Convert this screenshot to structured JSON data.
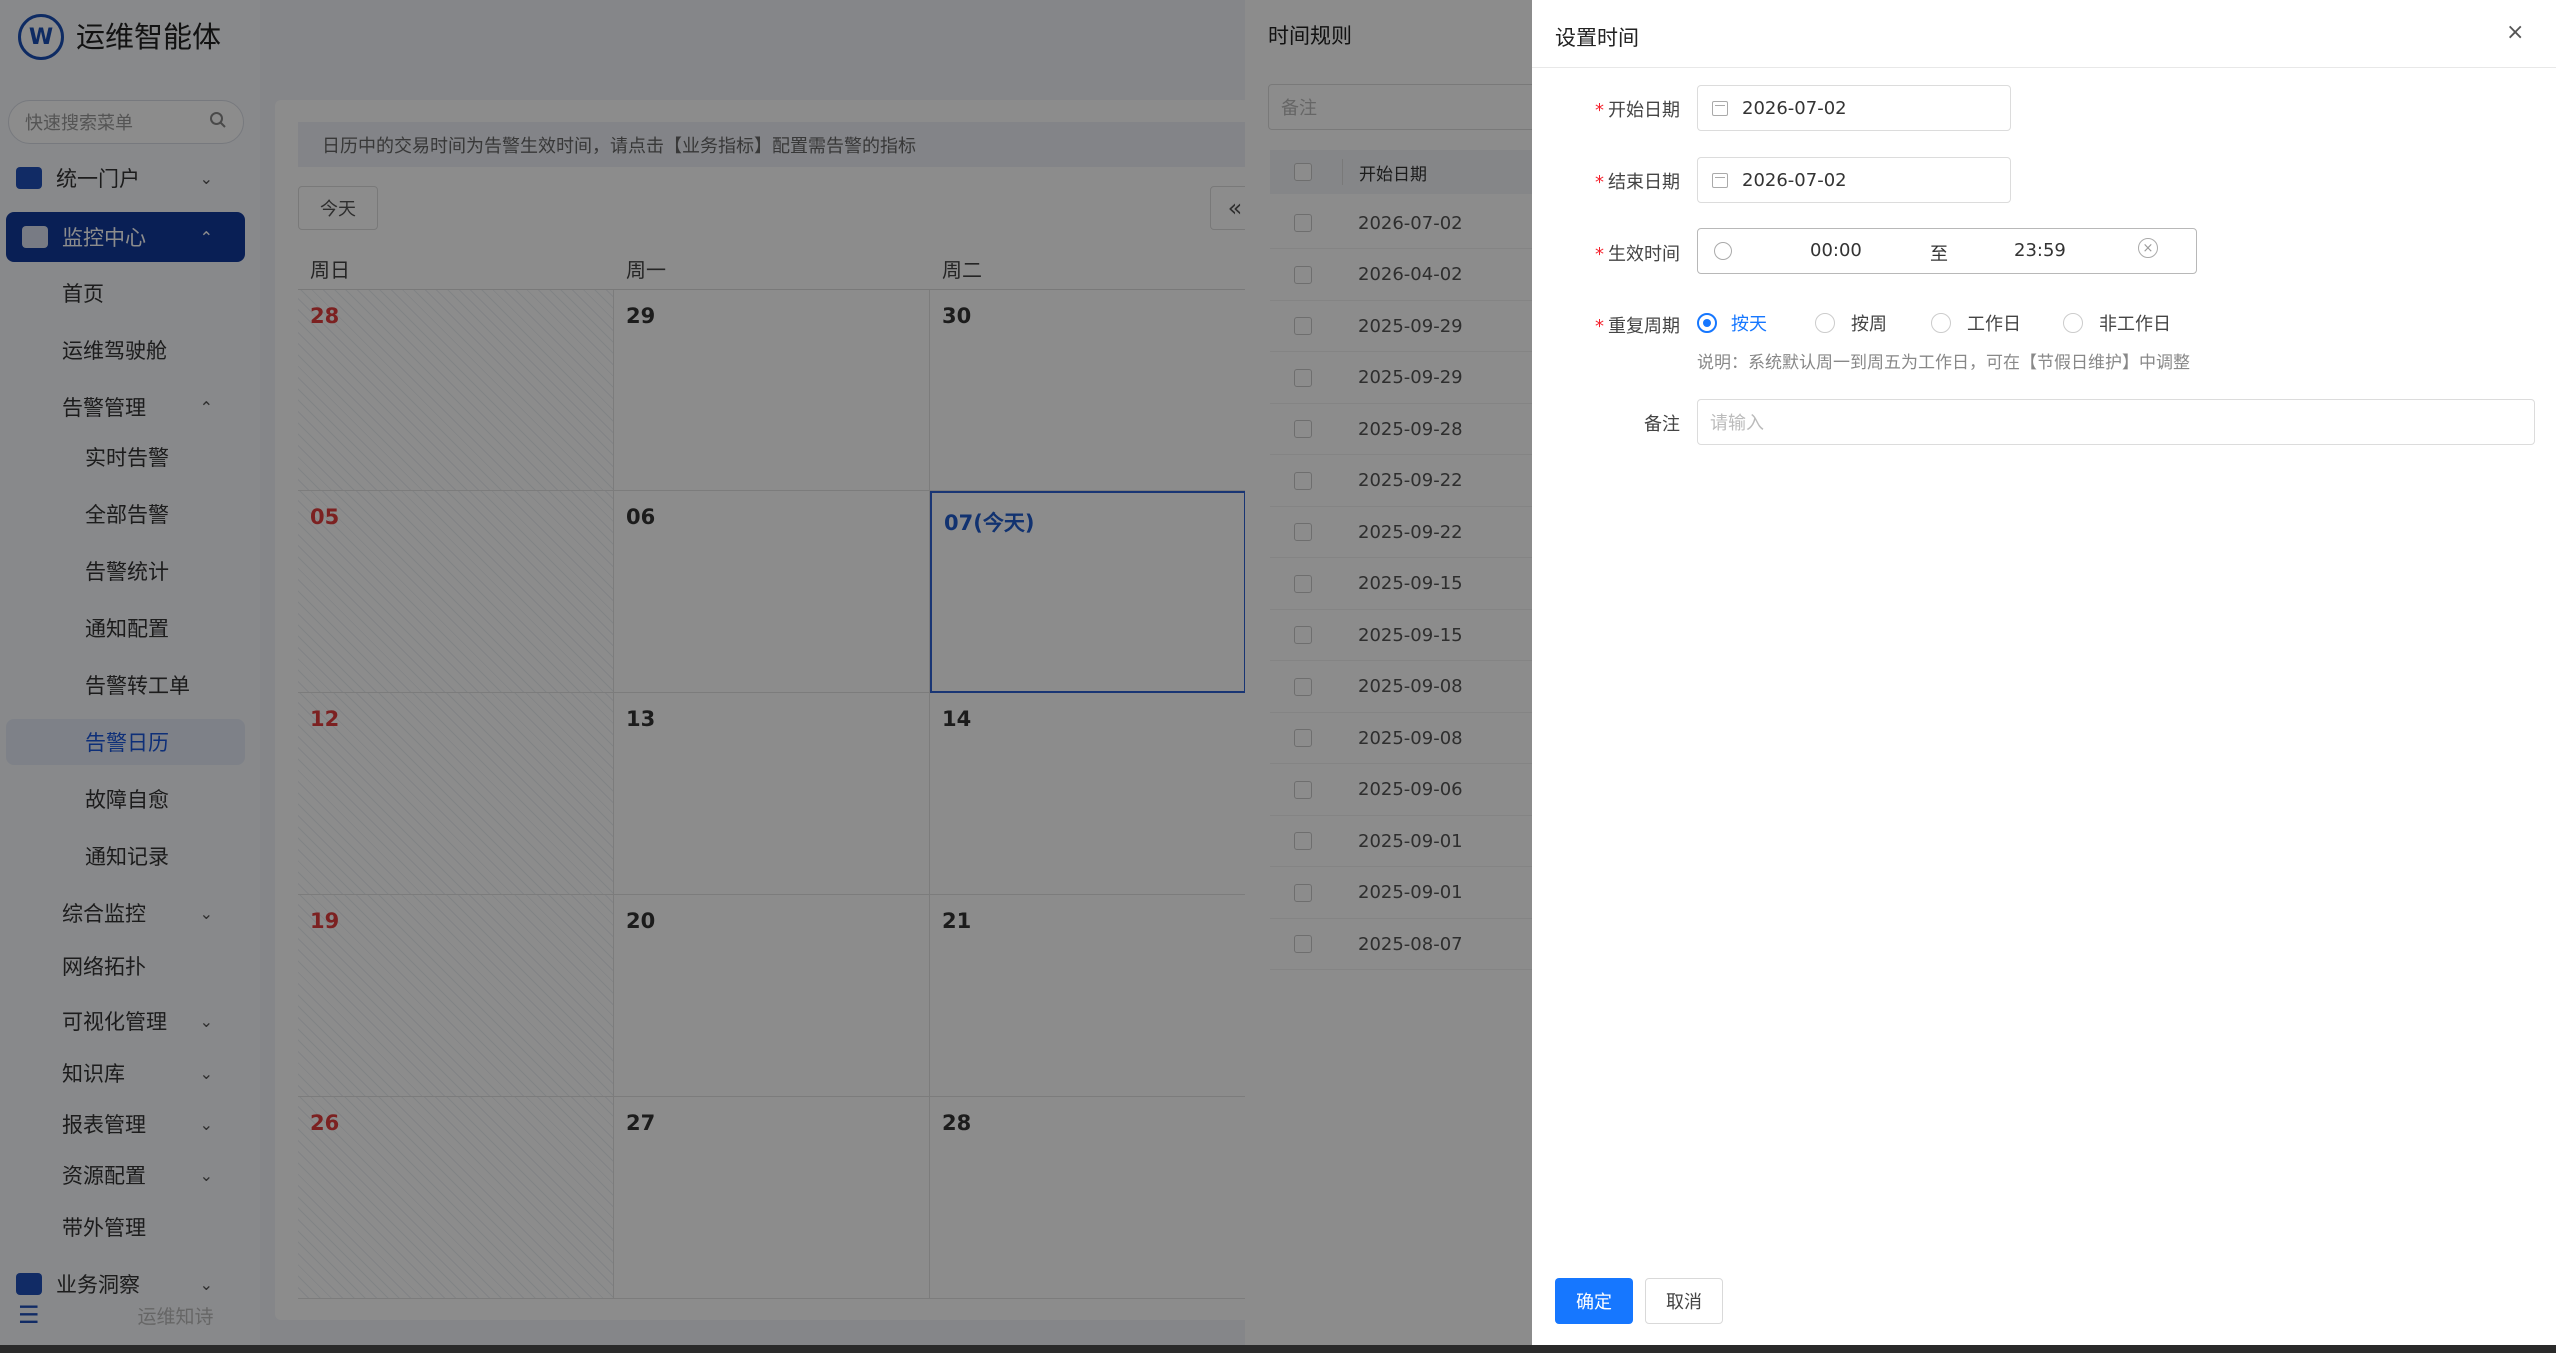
{
  "app": {
    "title": "运维智能体",
    "logo_text": "W"
  },
  "sidebar": {
    "search_placeholder": "快速搜索菜单",
    "items": [
      {
        "label": "统一门户"
      },
      {
        "label": "监控中心"
      },
      {
        "label": "首页"
      },
      {
        "label": "运维驾驶舱"
      },
      {
        "label": "告警管理"
      },
      {
        "label": "实时告警"
      },
      {
        "label": "全部告警"
      },
      {
        "label": "告警统计"
      },
      {
        "label": "通知配置"
      },
      {
        "label": "告警转工单"
      },
      {
        "label": "告警日历"
      },
      {
        "label": "故障自愈"
      },
      {
        "label": "通知记录"
      },
      {
        "label": "综合监控"
      },
      {
        "label": "网络拓扑"
      },
      {
        "label": "可视化管理"
      },
      {
        "label": "知识库"
      },
      {
        "label": "报表管理"
      },
      {
        "label": "资源配置"
      },
      {
        "label": "带外管理"
      },
      {
        "label": "业务洞察"
      }
    ],
    "footer_text": "运维知诗"
  },
  "calendar": {
    "notice": "日历中的交易时间为告警生效时间，请点击【业务指标】配置需告警的指标",
    "today_button": "今天",
    "prev_button": "«",
    "weekdays": [
      "周日",
      "周一",
      "周二"
    ],
    "rows": [
      [
        "28",
        "29",
        "30"
      ],
      [
        "05",
        "06",
        "07(今天)"
      ],
      [
        "12",
        "13",
        "14"
      ],
      [
        "19",
        "20",
        "21"
      ],
      [
        "26",
        "27",
        "28"
      ]
    ]
  },
  "rules_panel": {
    "title": "时间规则",
    "remark_placeholder": "备注",
    "column_start_date": "开始日期",
    "dates": [
      "2026-07-02",
      "2026-04-02",
      "2025-09-29",
      "2025-09-29",
      "2025-09-28",
      "2025-09-22",
      "2025-09-22",
      "2025-09-15",
      "2025-09-15",
      "2025-09-08",
      "2025-09-08",
      "2025-09-06",
      "2025-09-01",
      "2025-09-01",
      "2025-08-07"
    ]
  },
  "drawer": {
    "title": "设置时间",
    "close_glyph": "×",
    "start_date_label": "开始日期",
    "start_date_value": "2026-07-02",
    "end_date_label": "结束日期",
    "end_date_value": "2026-07-02",
    "effective_time_label": "生效时间",
    "time_start": "00:00",
    "time_sep": "至",
    "time_end": "23:59",
    "repeat_label": "重复周期",
    "repeat_options": [
      "按天",
      "按周",
      "工作日",
      "非工作日"
    ],
    "repeat_selected": "按天",
    "hint": "说明：系统默认周一到周五为工作日，可在【节假日维护】中调整",
    "remark_label": "备注",
    "remark_placeholder": "请输入",
    "confirm": "确定",
    "cancel": "取消",
    "accent_color": "#1677ff"
  }
}
